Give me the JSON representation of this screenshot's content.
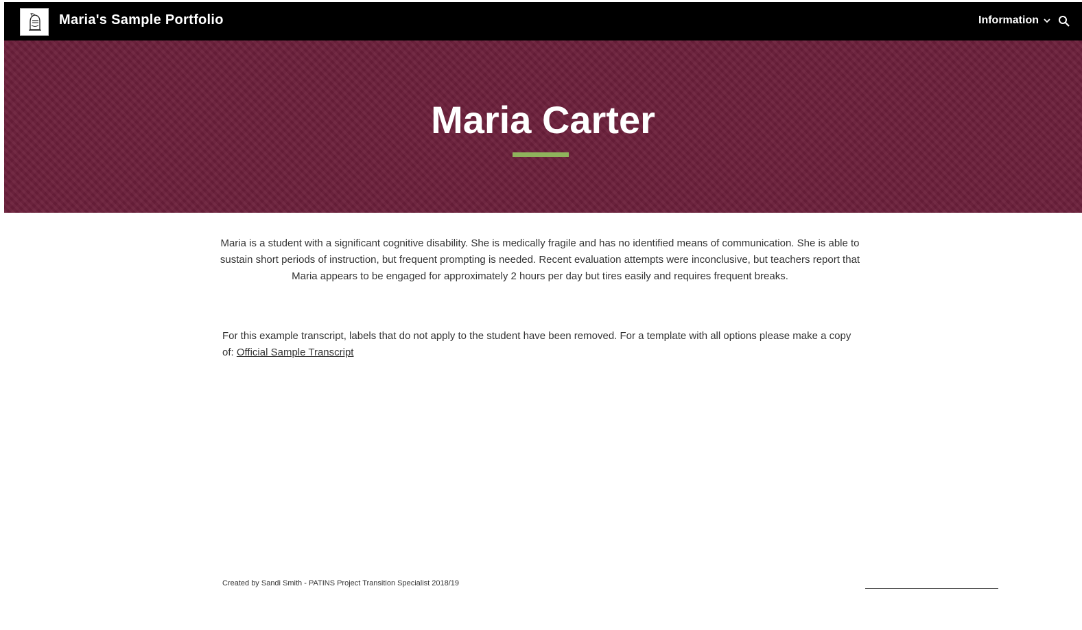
{
  "site": {
    "title": "Maria's Sample Portfolio",
    "logo_icon": "knight-helmet-icon"
  },
  "nav": {
    "items": [
      {
        "label": "Information",
        "has_dropdown": true
      }
    ],
    "search_icon": "search-icon"
  },
  "hero": {
    "title": "Maria Carter",
    "background_color": "#6b1f3a",
    "accent_color": "#8fb35c"
  },
  "content": {
    "intro": "Maria is a student with a significant cognitive disability. She is medically fragile and has no identified means of communication. She is able to sustain short periods of instruction, but frequent prompting is needed. Recent evaluation attempts were inconclusive, but teachers report that Maria appears to be engaged for approximately 2 hours per day but tires easily and requires frequent breaks.",
    "note_text": "For this example transcript, labels that do not apply to the student have been removed. For a template with all options please make a copy of: ",
    "note_link": "Official Sample Transcript"
  },
  "footer": {
    "credit": "Created by Sandi Smith - PATINS Project Transition Specialist 2018/19"
  }
}
